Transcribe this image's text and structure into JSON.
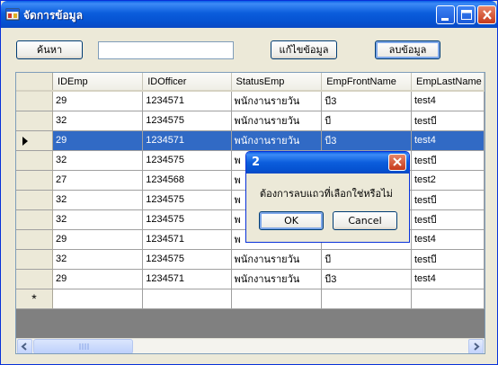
{
  "window": {
    "title": "จัดการข้อมูล"
  },
  "toolbar": {
    "search_label": "ค้นหา",
    "search_value": "",
    "edit_label": "แก้ไขข้อมูล",
    "delete_label": "ลบข้อมูล"
  },
  "grid": {
    "columns": [
      "IDEmp",
      "IDOfficer",
      "StatusEmp",
      "EmpFrontName",
      "EmpLastName"
    ],
    "rows": [
      [
        "29",
        "1234571",
        "พนักงานรายวัน",
        "บี3",
        "test4"
      ],
      [
        "32",
        "1234575",
        "พนักงานรายวัน",
        "บี",
        "testบี"
      ],
      [
        "29",
        "1234571",
        "พนักงานรายวัน",
        "บี3",
        "test4"
      ],
      [
        "32",
        "1234575",
        "พ",
        "",
        "testบี"
      ],
      [
        "27",
        "1234568",
        "พ",
        "",
        "test2"
      ],
      [
        "32",
        "1234575",
        "พ",
        "",
        "testบี"
      ],
      [
        "32",
        "1234575",
        "พ",
        "",
        "testบี"
      ],
      [
        "29",
        "1234571",
        "พ",
        "",
        "test4"
      ],
      [
        "32",
        "1234575",
        "พนักงานรายวัน",
        "บี",
        "testบี"
      ],
      [
        "29",
        "1234571",
        "พนักงานรายวัน",
        "บี3",
        "test4"
      ]
    ],
    "selected_row": 2,
    "new_row_marker": "*"
  },
  "dialog": {
    "title": "2",
    "message": "ต้องการลบแถวที่เลือกใช่หรือไม่",
    "ok_label": "OK",
    "cancel_label": "Cancel"
  },
  "colors": {
    "title_bar": "#0b5ddc",
    "selection": "#316ac5",
    "close_button": "#c6391b"
  }
}
